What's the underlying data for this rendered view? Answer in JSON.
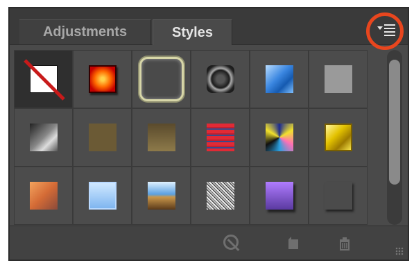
{
  "tabs": [
    {
      "label": "Adjustments",
      "active": false
    },
    {
      "label": "Styles",
      "active": true
    }
  ],
  "styles_grid": [
    {
      "name": "no-style-swatch",
      "selected": true
    },
    {
      "name": "red-glow-swatch"
    },
    {
      "name": "outline-glow-swatch"
    },
    {
      "name": "bevel-ring-swatch"
    },
    {
      "name": "blue-glass-swatch"
    },
    {
      "name": "gray-plain-swatch"
    },
    {
      "name": "gray-metal-swatch"
    },
    {
      "name": "olive-flat-swatch"
    },
    {
      "name": "olive-gradient-swatch"
    },
    {
      "name": "red-striped-swatch"
    },
    {
      "name": "psychedelic-swatch"
    },
    {
      "name": "gold-bevel-swatch"
    },
    {
      "name": "sunset-swatch"
    },
    {
      "name": "light-blue-swatch"
    },
    {
      "name": "landscape-swatch"
    },
    {
      "name": "noise-texture-swatch"
    },
    {
      "name": "purple-gradient-swatch"
    },
    {
      "name": "dark-gray-shadow-swatch"
    }
  ],
  "footer_icons": [
    "clear-style-icon",
    "new-style-icon",
    "delete-style-icon"
  ],
  "colors": {
    "panel_bg": "#4a4a4a",
    "highlight_circle": "#e8461e"
  }
}
